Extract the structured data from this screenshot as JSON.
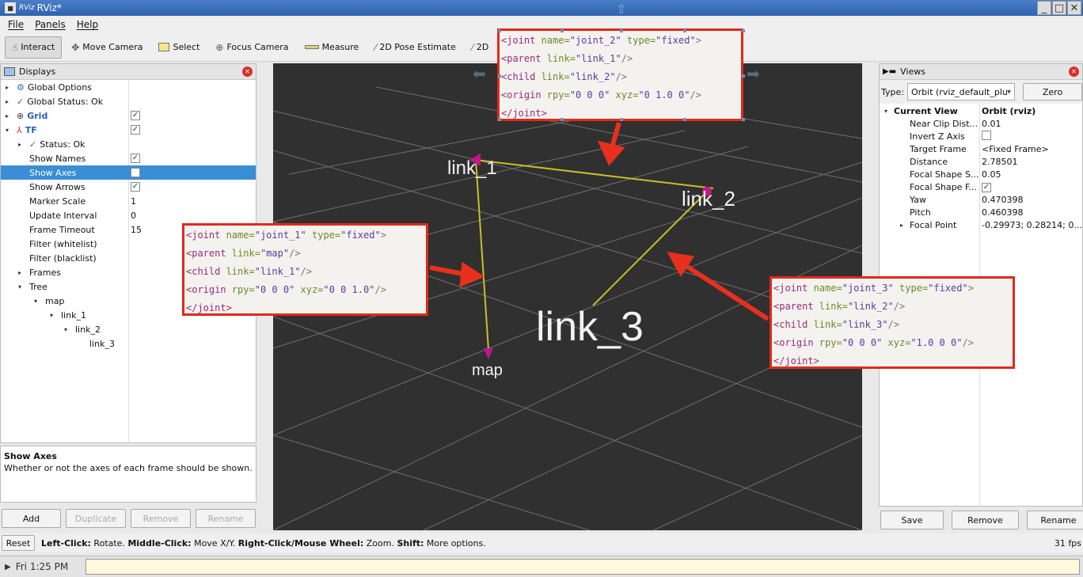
{
  "window": {
    "app_icon": "RViz",
    "title": "RViz*"
  },
  "menu": [
    "File",
    "Panels",
    "Help"
  ],
  "toolbar": [
    {
      "label": "Interact",
      "icon": "hand-icon",
      "active": true
    },
    {
      "label": "Move Camera",
      "icon": "move-camera-icon"
    },
    {
      "label": "Select",
      "icon": "select-icon"
    },
    {
      "label": "Focus Camera",
      "icon": "focus-camera-icon"
    },
    {
      "label": "Measure",
      "icon": "measure-icon"
    },
    {
      "label": "2D Pose Estimate",
      "icon": "pose-estimate-icon"
    },
    {
      "label": "2D",
      "icon": "nav-goal-icon"
    }
  ],
  "displays": {
    "title": "Displays",
    "rows": [
      {
        "label": "Global Options",
        "value": "",
        "indent": 0,
        "arrow": "▸",
        "icon": "globe-icon"
      },
      {
        "label": "Global Status: Ok",
        "value": "",
        "indent": 0,
        "arrow": "▸",
        "icon": "check-icon"
      },
      {
        "label": "Grid",
        "value": "check",
        "indent": 0,
        "arrow": "▸",
        "icon": "grid-icon",
        "bold": true
      },
      {
        "label": "TF",
        "value": "check",
        "indent": 0,
        "arrow": "▾",
        "icon": "tf-icon",
        "bold": true
      },
      {
        "label": "Status: Ok",
        "value": "",
        "indent": 1,
        "arrow": "▸",
        "icon": "check-icon"
      },
      {
        "label": "Show Names",
        "value": "check",
        "indent": 1,
        "arrow": ""
      },
      {
        "label": "Show Axes",
        "value": "uncheck",
        "indent": 1,
        "arrow": "",
        "selected": true
      },
      {
        "label": "Show Arrows",
        "value": "check",
        "indent": 1,
        "arrow": ""
      },
      {
        "label": "Marker Scale",
        "value": "1",
        "indent": 1,
        "arrow": ""
      },
      {
        "label": "Update Interval",
        "value": "0",
        "indent": 1,
        "arrow": ""
      },
      {
        "label": "Frame Timeout",
        "value": "15",
        "indent": 1,
        "arrow": ""
      },
      {
        "label": "Filter (whitelist)",
        "value": "",
        "indent": 1,
        "arrow": ""
      },
      {
        "label": "Filter (blacklist)",
        "value": "",
        "indent": 1,
        "arrow": ""
      },
      {
        "label": "Frames",
        "value": "",
        "indent": 1,
        "arrow": "▸"
      },
      {
        "label": "Tree",
        "value": "",
        "indent": 1,
        "arrow": "▾"
      },
      {
        "label": "map",
        "value": "",
        "indent": 2,
        "arrow": "▾"
      },
      {
        "label": "link_1",
        "value": "",
        "indent": 3,
        "arrow": "▾"
      },
      {
        "label": "link_2",
        "value": "",
        "indent": 4,
        "arrow": "▾"
      },
      {
        "label": "link_3",
        "value": "",
        "indent": 5,
        "arrow": ""
      }
    ],
    "description_title": "Show Axes",
    "description_text": "Whether or not the axes of each frame should be shown.",
    "buttons": [
      "Add",
      "Duplicate",
      "Remove",
      "Rename"
    ]
  },
  "views": {
    "title": "Views",
    "type_label": "Type:",
    "type_value": "Orbit (rviz_default_plu",
    "zero_label": "Zero",
    "rows": [
      {
        "label": "Current View",
        "value": "Orbit (rviz)",
        "bold": true,
        "arrow": "▾",
        "indent": 0
      },
      {
        "label": "Near Clip Dist...",
        "value": "0.01",
        "indent": 1
      },
      {
        "label": "Invert Z Axis",
        "value": "uncheck",
        "indent": 1
      },
      {
        "label": "Target Frame",
        "value": "<Fixed Frame>",
        "indent": 1
      },
      {
        "label": "Distance",
        "value": "2.78501",
        "indent": 1
      },
      {
        "label": "Focal Shape S...",
        "value": "0.05",
        "indent": 1
      },
      {
        "label": "Focal Shape F...",
        "value": "check",
        "indent": 1
      },
      {
        "label": "Yaw",
        "value": "0.470398",
        "indent": 1
      },
      {
        "label": "Pitch",
        "value": "0.460398",
        "indent": 1
      },
      {
        "label": "Focal Point",
        "value": "-0.29973; 0.28214; 0....",
        "indent": 1,
        "arrow": "▸"
      }
    ],
    "buttons": [
      "Save",
      "Remove",
      "Rename"
    ]
  },
  "scene": {
    "frames": [
      "link_1",
      "link_2",
      "link_3",
      "map"
    ]
  },
  "annotations": [
    {
      "name": "joint_2",
      "parent": "link_1",
      "child": "link_2",
      "rpy": "0 0 0",
      "xyz": "0 1.0 0"
    },
    {
      "name": "joint_1",
      "parent": "map",
      "child": "link_1",
      "rpy": "0 0 0",
      "xyz": "0 0 1.0"
    },
    {
      "name": "joint_3",
      "parent": "link_2",
      "child": "link_3",
      "rpy": "0 0 0",
      "xyz": "1.0 0 0"
    }
  ],
  "code": {
    "joint_open": "<joint",
    "name_attr": " name=",
    "type_attr": " type=",
    "fixed": "\"fixed\"",
    "parent_open": "<parent",
    "child_open": "<child",
    "origin_open": "<origin",
    "link_attr": " link=",
    "rpy_attr": " rpy=",
    "xyz_attr": " xyz=",
    "self_close": "/>",
    "close_gt": ">",
    "joint_close": "</joint>"
  },
  "status": {
    "reset_label": "Reset",
    "hint_parts": [
      {
        "text": "Left-Click:",
        "bold": true
      },
      {
        "text": " Rotate. ",
        "bold": false
      },
      {
        "text": "Middle-Click:",
        "bold": true
      },
      {
        "text": " Move X/Y. ",
        "bold": false
      },
      {
        "text": "Right-Click/Mouse Wheel:",
        "bold": true
      },
      {
        "text": " Zoom. ",
        "bold": false
      },
      {
        "text": "Shift:",
        "bold": true
      },
      {
        "text": " More options.",
        "bold": false
      }
    ],
    "fps": "31 fps"
  },
  "taskbar": {
    "clock": "Fri  1:25 PM"
  }
}
